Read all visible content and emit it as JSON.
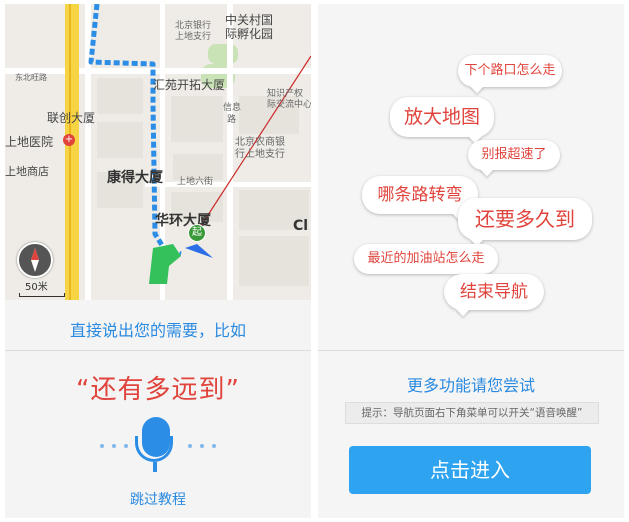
{
  "map": {
    "labels": {
      "zgc_1": "中关村国",
      "zgc_2": "际孵化园",
      "bank_bj_1": "北京银行",
      "bank_bj_2": "上地支行",
      "east_north_road": "东北旺路",
      "huiyuan": "汇苑开拓大厦",
      "lianchuang": "联创大厦",
      "hospital": "上地医院",
      "shangdi_mall": "上地商店",
      "zhishi_1": "知识产权",
      "zhishi_2": "际交流中心",
      "xinxi_1": "信息",
      "xinxi_2": "路",
      "nongshang_1": "北京农商银",
      "nongshang_2": "行上地支行",
      "kangde": "康得大厦",
      "shangdi_6": "上地六街",
      "huahuan": "华环大厦",
      "cl": "Cl",
      "start": "起"
    },
    "scale": "50米",
    "colors": {
      "route": "#2b8de6",
      "road": "#f7d444"
    }
  },
  "left": {
    "hint": "直接说出您的需要，比如",
    "quote": "“还有多远到”",
    "skip": "跳过教程"
  },
  "right": {
    "bubbles": [
      "下个路口怎么走",
      "放大地图",
      "别报超速了",
      "哪条路转弯",
      "还要多久到",
      "最近的加油站怎么走",
      "结束导航"
    ],
    "more": "更多功能请您尝试",
    "tip": "提示：导航页面右下角菜单可以开关“语音唤醒”",
    "enter": "点击进入"
  },
  "colors": {
    "accent": "#2a8ae0",
    "quote": "#e0443c",
    "button": "#2ea3ef"
  },
  "icons": [
    "compass-icon",
    "microphone-icon",
    "hospital-icon",
    "start-marker-icon",
    "navigation-arrow-icon"
  ]
}
